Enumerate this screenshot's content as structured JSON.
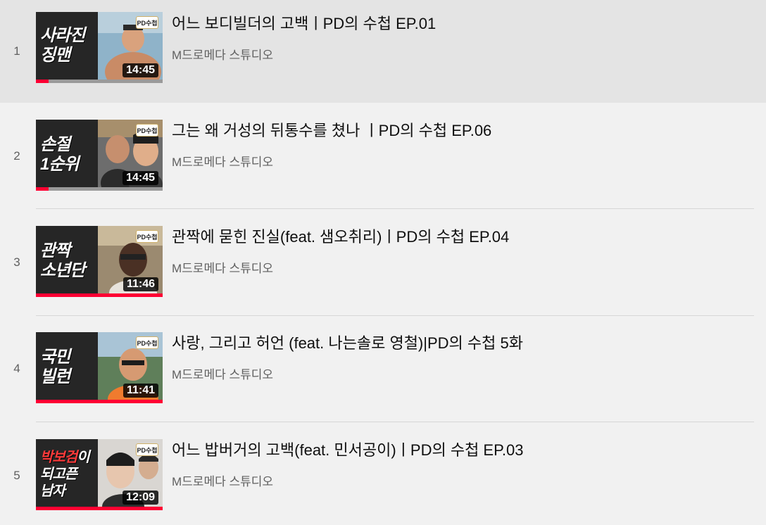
{
  "playlist": {
    "items": [
      {
        "index": "1",
        "title": "어느 보디빌더의 고백ㅣPD의 수첩 EP.01",
        "channel": "M드로메다 스튜디오",
        "duration": "14:45",
        "caption_line1": "사라진",
        "caption_line2": "징맨",
        "logo": "PD수첩",
        "watched_fraction": 0.1,
        "active": true
      },
      {
        "index": "2",
        "title": "그는 왜 거성의 뒤통수를 쳤나 ㅣPD의 수첩 EP.06",
        "channel": "M드로메다 스튜디오",
        "duration": "14:45",
        "caption_line1": "손절",
        "caption_line2": "1순위",
        "logo": "PD수첩",
        "watched_fraction": 0.1
      },
      {
        "index": "3",
        "title": "관짝에 묻힌 진실(feat. 샘오취리)ㅣPD의 수첩 EP.04",
        "channel": "M드로메다 스튜디오",
        "duration": "11:46",
        "caption_line1": "관짝",
        "caption_line2": "소년단",
        "logo": "PD수첩",
        "watched_fraction": 1.0
      },
      {
        "index": "4",
        "title": "사랑, 그리고 허언 (feat. 나는솔로 영철)|PD의 수첩 5화",
        "channel": "M드로메다 스튜디오",
        "duration": "11:41",
        "caption_line1": "국민",
        "caption_line2": "빌런",
        "logo": "PD수첩",
        "watched_fraction": 1.0
      },
      {
        "index": "5",
        "title": "어느 밥버거의 고백(feat. 민서공이)ㅣPD의 수첩 EP.03",
        "channel": "M드로메다 스튜디오",
        "duration": "12:09",
        "caption_line1_red": "박보검",
        "caption_line1_rest": "이",
        "caption_line2": "되고픈",
        "caption_line3": "남자",
        "logo": "PD수첩",
        "watched_fraction": 1.0
      }
    ]
  },
  "colors": {
    "active_row_bg": "#e4e4e4",
    "page_bg": "#f1f1f1",
    "progress_red": "#ff0033"
  }
}
